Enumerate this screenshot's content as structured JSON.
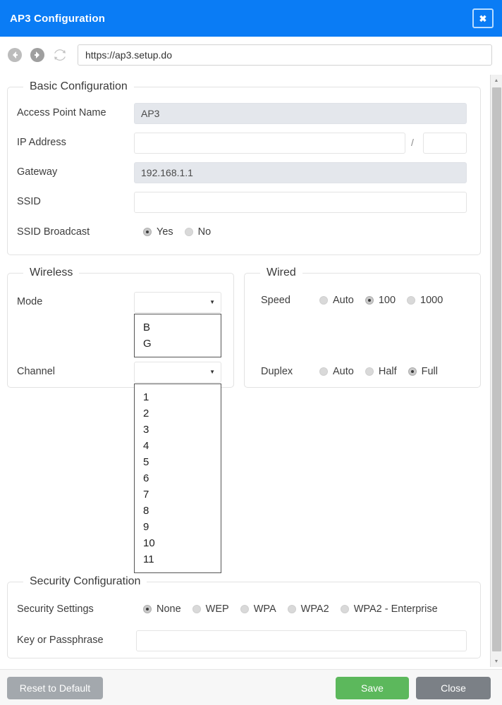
{
  "window": {
    "title": "AP3 Configuration",
    "close_icon": "close-icon",
    "close_glyph": "✖",
    "titlebar_color": "#0a7cf5"
  },
  "browser": {
    "back_icon": "back-icon",
    "forward_icon": "forward-icon",
    "reload_icon": "reload-icon",
    "url": "https://ap3.setup.do"
  },
  "basic": {
    "legend": "Basic Configuration",
    "access_point_name": {
      "label": "Access Point Name",
      "value": "AP3",
      "readonly": true
    },
    "ip_address": {
      "label": "IP Address",
      "value": "",
      "placeholder": "",
      "separator": "/",
      "prefix_value": ""
    },
    "gateway": {
      "label": "Gateway",
      "value": "192.168.1.1",
      "readonly": true
    },
    "ssid": {
      "label": "SSID",
      "value": ""
    },
    "ssid_broadcast": {
      "label": "SSID Broadcast",
      "options": [
        "Yes",
        "No"
      ],
      "selected": "Yes"
    }
  },
  "wireless": {
    "legend": "Wireless",
    "mode": {
      "label": "Mode",
      "value": "",
      "expanded": true,
      "options": [
        "B",
        "G"
      ]
    },
    "channel": {
      "label": "Channel",
      "value": "",
      "expanded": true,
      "options": [
        "1",
        "2",
        "3",
        "4",
        "5",
        "6",
        "7",
        "8",
        "9",
        "10",
        "11"
      ]
    }
  },
  "wired": {
    "legend": "Wired",
    "speed": {
      "label": "Speed",
      "options": [
        "Auto",
        "100",
        "1000"
      ],
      "selected": "100"
    },
    "duplex": {
      "label": "Duplex",
      "options": [
        "Auto",
        "Half",
        "Full"
      ],
      "selected": "Full"
    }
  },
  "security": {
    "legend": "Security Configuration",
    "settings": {
      "label": "Security Settings",
      "options": [
        "None",
        "WEP",
        "WPA",
        "WPA2",
        "WPA2 - Enterprise"
      ],
      "selected": "None"
    },
    "key": {
      "label": "Key or Passphrase",
      "value": ""
    }
  },
  "footer": {
    "reset_label": "Reset to Default",
    "save_label": "Save",
    "close_label": "Close",
    "save_color": "#5cb85c",
    "close_color": "#7b8086",
    "reset_color": "#a3a8ad"
  },
  "scrollbar": {
    "up_glyph": "▲",
    "down_glyph": "▼"
  }
}
